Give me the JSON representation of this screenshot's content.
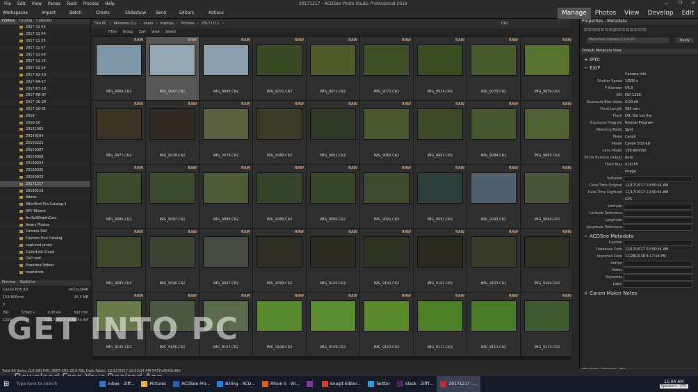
{
  "window": {
    "title": "20171217 - ACDSee Photo Studio Professional 2019",
    "menu": [
      "File",
      "Edit",
      "View",
      "Panes",
      "Tools",
      "Process",
      "Help"
    ],
    "controls": [
      "—",
      "❐",
      "✕"
    ]
  },
  "toolbar": {
    "items": [
      "Workspaces",
      "Import",
      "Batch",
      "Create",
      "Slideshow",
      "Send",
      "Editors",
      "Actions"
    ]
  },
  "modes": [
    {
      "label": "Manage",
      "active": true
    },
    {
      "label": "Photos"
    },
    {
      "label": "View"
    },
    {
      "label": "Develop"
    },
    {
      "label": "Edit"
    }
  ],
  "left_tabs": [
    "Folders",
    "Catalog",
    "Calendar"
  ],
  "folders": [
    "2017 11 03",
    "2017 11 04",
    "2017 11 05",
    "2017 11 07",
    "2017 11 08",
    "2017 11 10",
    "2017 11 14",
    "2017-02-10",
    "2017-04-17",
    "2017-07-18",
    "2017-08-07",
    "2017-10-28",
    "2017-10-31",
    "2018",
    "2018-10",
    "20131002",
    "20140204",
    "20150221",
    "20150307",
    "20150308",
    "20160204",
    "20160325",
    "20160923",
    "20171217",
    "20180119",
    "Adobe",
    "AfterShot Pro Catalog 3",
    "APC Wizard",
    "ArcSoftDepthCam",
    "Aviary Photos",
    "Camera Roll",
    "Capture One Catalog",
    "captured photo",
    "CyberLink Cloud",
    "DxO test",
    "Exported Videos",
    "headshots"
  ],
  "selected_folder": "20171217",
  "preview": {
    "tabs": [
      "Preview",
      "SeeDrive"
    ],
    "camera": "Canon EOS 6D",
    "size": "5472x3648",
    "lens": "150-600mm",
    "filesize": "25.5 MB",
    "mode": "P",
    "shutter": "1/500 s",
    "ev": "0.00 eV",
    "focal": "562 mm",
    "iso_label": "ISO",
    "iso": "1250",
    "datetime": "12/17/2017 10:50:54 AM"
  },
  "path": {
    "crumbs": [
      "This PC",
      "Windows (C:)",
      "Users",
      "mwmps",
      "Pictures",
      "20171217"
    ],
    "search": "CR2"
  },
  "filters": [
    "Filter",
    "Group",
    "Sort",
    "View",
    "Select"
  ],
  "files": [
    "IMG_9066.CR2",
    "IMG_9067.CR2",
    "IMG_9068.CR2",
    "IMG_9071.CR2",
    "IMG_9072.CR2",
    "IMG_9073.CR2",
    "IMG_9074.CR2",
    "IMG_9075.CR2",
    "IMG_9076.CR2",
    "IMG_9077.CR2",
    "IMG_9078.CR2",
    "IMG_9079.CR2",
    "IMG_9080.CR2",
    "IMG_9081.CR2",
    "IMG_9082.CR2",
    "IMG_9083.CR2",
    "IMG_9084.CR2",
    "IMG_9085.CR2",
    "IMG_9086.CR2",
    "IMG_9087.CR2",
    "IMG_9088.CR2",
    "IMG_9089.CR2",
    "IMG_9090.CR2",
    "IMG_9091.CR2",
    "IMG_9092.CR2",
    "IMG_9093.CR2",
    "IMG_9094.CR2",
    "IMG_9095.CR2",
    "IMG_9096.CR2",
    "IMG_9097.CR2",
    "IMG_9099.CR2",
    "IMG_9100.CR2",
    "IMG_9101.CR2",
    "IMG_9102.CR2",
    "IMG_9103.CR2",
    "IMG_9104.CR2",
    "IMG_9105.CR2",
    "IMG_9106.CR2",
    "IMG_9107.CR2",
    "IMG_9108.CR2",
    "IMG_9109.CR2",
    "IMG_9110.CR2",
    "IMG_9111.CR2",
    "IMG_9112.CR2",
    "IMG_9113.CR2"
  ],
  "raw_badge": "RAW",
  "thumb_colors": [
    "#7d97a8",
    "#94a8b4",
    "#8aa0ad",
    "#3a4a24",
    "#4e5a2a",
    "#3e5028",
    "#3a4c22",
    "#465a2c",
    "#57732f",
    "#3a3426",
    "#2f2a22",
    "#5a6040",
    "#3a3a26",
    "#303828",
    "#4a5830",
    "#3c4a28",
    "#465630",
    "#4e6032",
    "#3e4a2c",
    "#3a4a2a",
    "#4c5a38",
    "#34452a",
    "#38462a",
    "#404a2c",
    "#2e3e3a",
    "#506070",
    "#4a5438",
    "#40482e",
    "#3e4434",
    "#444a40",
    "#2e2e22",
    "#2c2c20",
    "#2e3222",
    "#2a2a1e",
    "#383a28",
    "#2e3022",
    "#6a7a4a",
    "#4a5840",
    "#5a6a4a",
    "#5a8a2e",
    "#5c8c30",
    "#5a8a2c",
    "#4e7e26",
    "#4a7a28",
    "#3e5a30"
  ],
  "selected_index": 1,
  "right": {
    "title": "Properties - Metadata",
    "preset_placeholder": "Metadata Presets (Ctrl+M)",
    "apply": "Apply",
    "view": "Default Metadata View",
    "sections": [
      "IPTC",
      "EXIF",
      "ACDSee Metadata",
      "Canon Maker Notes"
    ],
    "exif": [
      [
        "",
        "Camera Info"
      ],
      [
        "Shutter Speed",
        "1/500 s"
      ],
      [
        "F-Number",
        "f/6.3"
      ],
      [
        "ISO",
        "ISO 1250"
      ],
      [
        "Exposure Bias Value",
        "0.00 eV"
      ],
      [
        "Focal Length",
        "562 mm"
      ],
      [
        "Flash",
        "Off, Did not fire"
      ],
      [
        "Exposure Program",
        "Normal Program"
      ],
      [
        "Metering Mode",
        "Spot"
      ],
      [
        "Make",
        "Canon"
      ],
      [
        "Model",
        "Canon EOS 6D"
      ],
      [
        "Lens Model",
        "150-600mm"
      ],
      [
        "White Balance Details",
        "Auto"
      ],
      [
        "Flash Bias",
        "0.00 EV"
      ],
      [
        "",
        "Image"
      ],
      [
        "Software",
        ""
      ],
      [
        "Date/Time Original",
        "12/17/2017 10:50:54 AM"
      ],
      [
        "Date/Time Digitized",
        "12/17/2017 10:50:54 AM"
      ],
      [
        "",
        "GPS"
      ],
      [
        "Latitude",
        ""
      ],
      [
        "Latitude Reference",
        ""
      ],
      [
        "Longitude",
        ""
      ],
      [
        "Longitude Reference",
        ""
      ]
    ],
    "acd": [
      [
        "Caption",
        ""
      ],
      [
        "Database Date",
        "12/17/2017 10:50:54 AM"
      ],
      [
        "Imported Date",
        "11/28/2018 8:17:14 PM"
      ],
      [
        "Author",
        ""
      ],
      [
        "Notes",
        ""
      ],
      [
        "Keywords",
        ""
      ],
      [
        "Label",
        ""
      ]
    ],
    "tabs": [
      "Metadata",
      "Organize",
      "File"
    ]
  },
  "status": "Total 60 items (1.6 GB)   IMG_9067.CR2   25.5 MB, Date Taken: 12/17/2017 10:50:54 AM   5472x3648x48b",
  "watermark": {
    "main": "GET INTO PC",
    "sub": "Download Free Your Desired App"
  },
  "taskbar": {
    "search": "Type here to search",
    "apps": [
      "Inbox - Ziff...",
      "Pictures",
      "ACDSee Pro...",
      "Billing - ACD...",
      "Rhein II - Wi...",
      "",
      "Snagit Editor...",
      "Twitter",
      "Slack - ZiffT...",
      "20171217 -..."
    ],
    "time": "11:04 AM",
    "date": "11/29/2018",
    "tooltip": "20171217 - ACDSee Photo Studio Professional 2019",
    "speakers": "Speakers: 23%"
  }
}
